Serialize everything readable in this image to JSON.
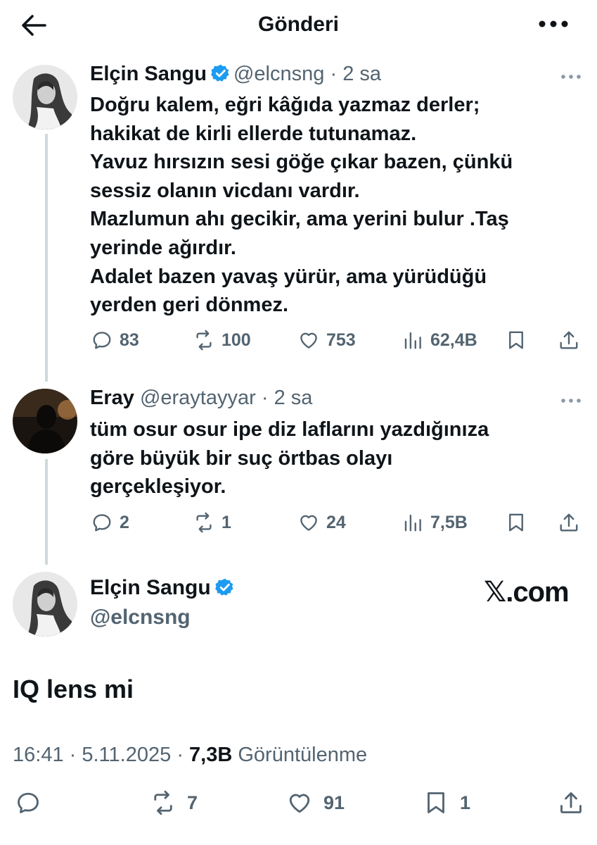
{
  "header": {
    "title": "Gönderi"
  },
  "tweets": [
    {
      "name": "Elçin Sangu",
      "handle": "@elcnsng",
      "dot": "·",
      "time": "2 sa",
      "text": "Doğru kalem, eğri kâğıda yazmaz derler;\nhakikat de kirli ellerde tutunamaz.\nYavuz hırsızın sesi göğe çıkar bazen, çünkü\nsessiz olanın vicdanı vardır.\nMazlumun ahı gecikir, ama yerini bulur .Taş\nyerinde ağırdır.\nAdalet bazen yavaş yürür, ama yürüdüğü\nyerden geri dönmez.",
      "replies": "83",
      "retweets": "100",
      "likes": "753",
      "views": "62,4B"
    },
    {
      "name": "Eray",
      "handle": "@eraytayyar",
      "dot": "·",
      "time": "2 sa",
      "text": "tüm osur osur ipe diz laflarını yazdığınıza\ngöre büyük bir suç örtbas olayı\ngerçekleşiyor.",
      "replies": "2",
      "retweets": "1",
      "likes": "24",
      "views": "7,5B"
    }
  ],
  "main_tweet": {
    "name": "Elçin Sangu",
    "handle": "@elcnsng",
    "watermark": "𝕏.com",
    "text": "IQ lens mi",
    "time": "16:41",
    "sep1": "·",
    "date": "5.11.2025",
    "sep2": "·",
    "views": "7,3B",
    "views_label": "Görüntülenme",
    "retweets": "7",
    "likes": "91",
    "bookmarks": "1"
  },
  "colors": {
    "verified": "#1d9bf0",
    "secondary": "#536471",
    "text": "#0f1419",
    "thread": "#cfd9de"
  }
}
